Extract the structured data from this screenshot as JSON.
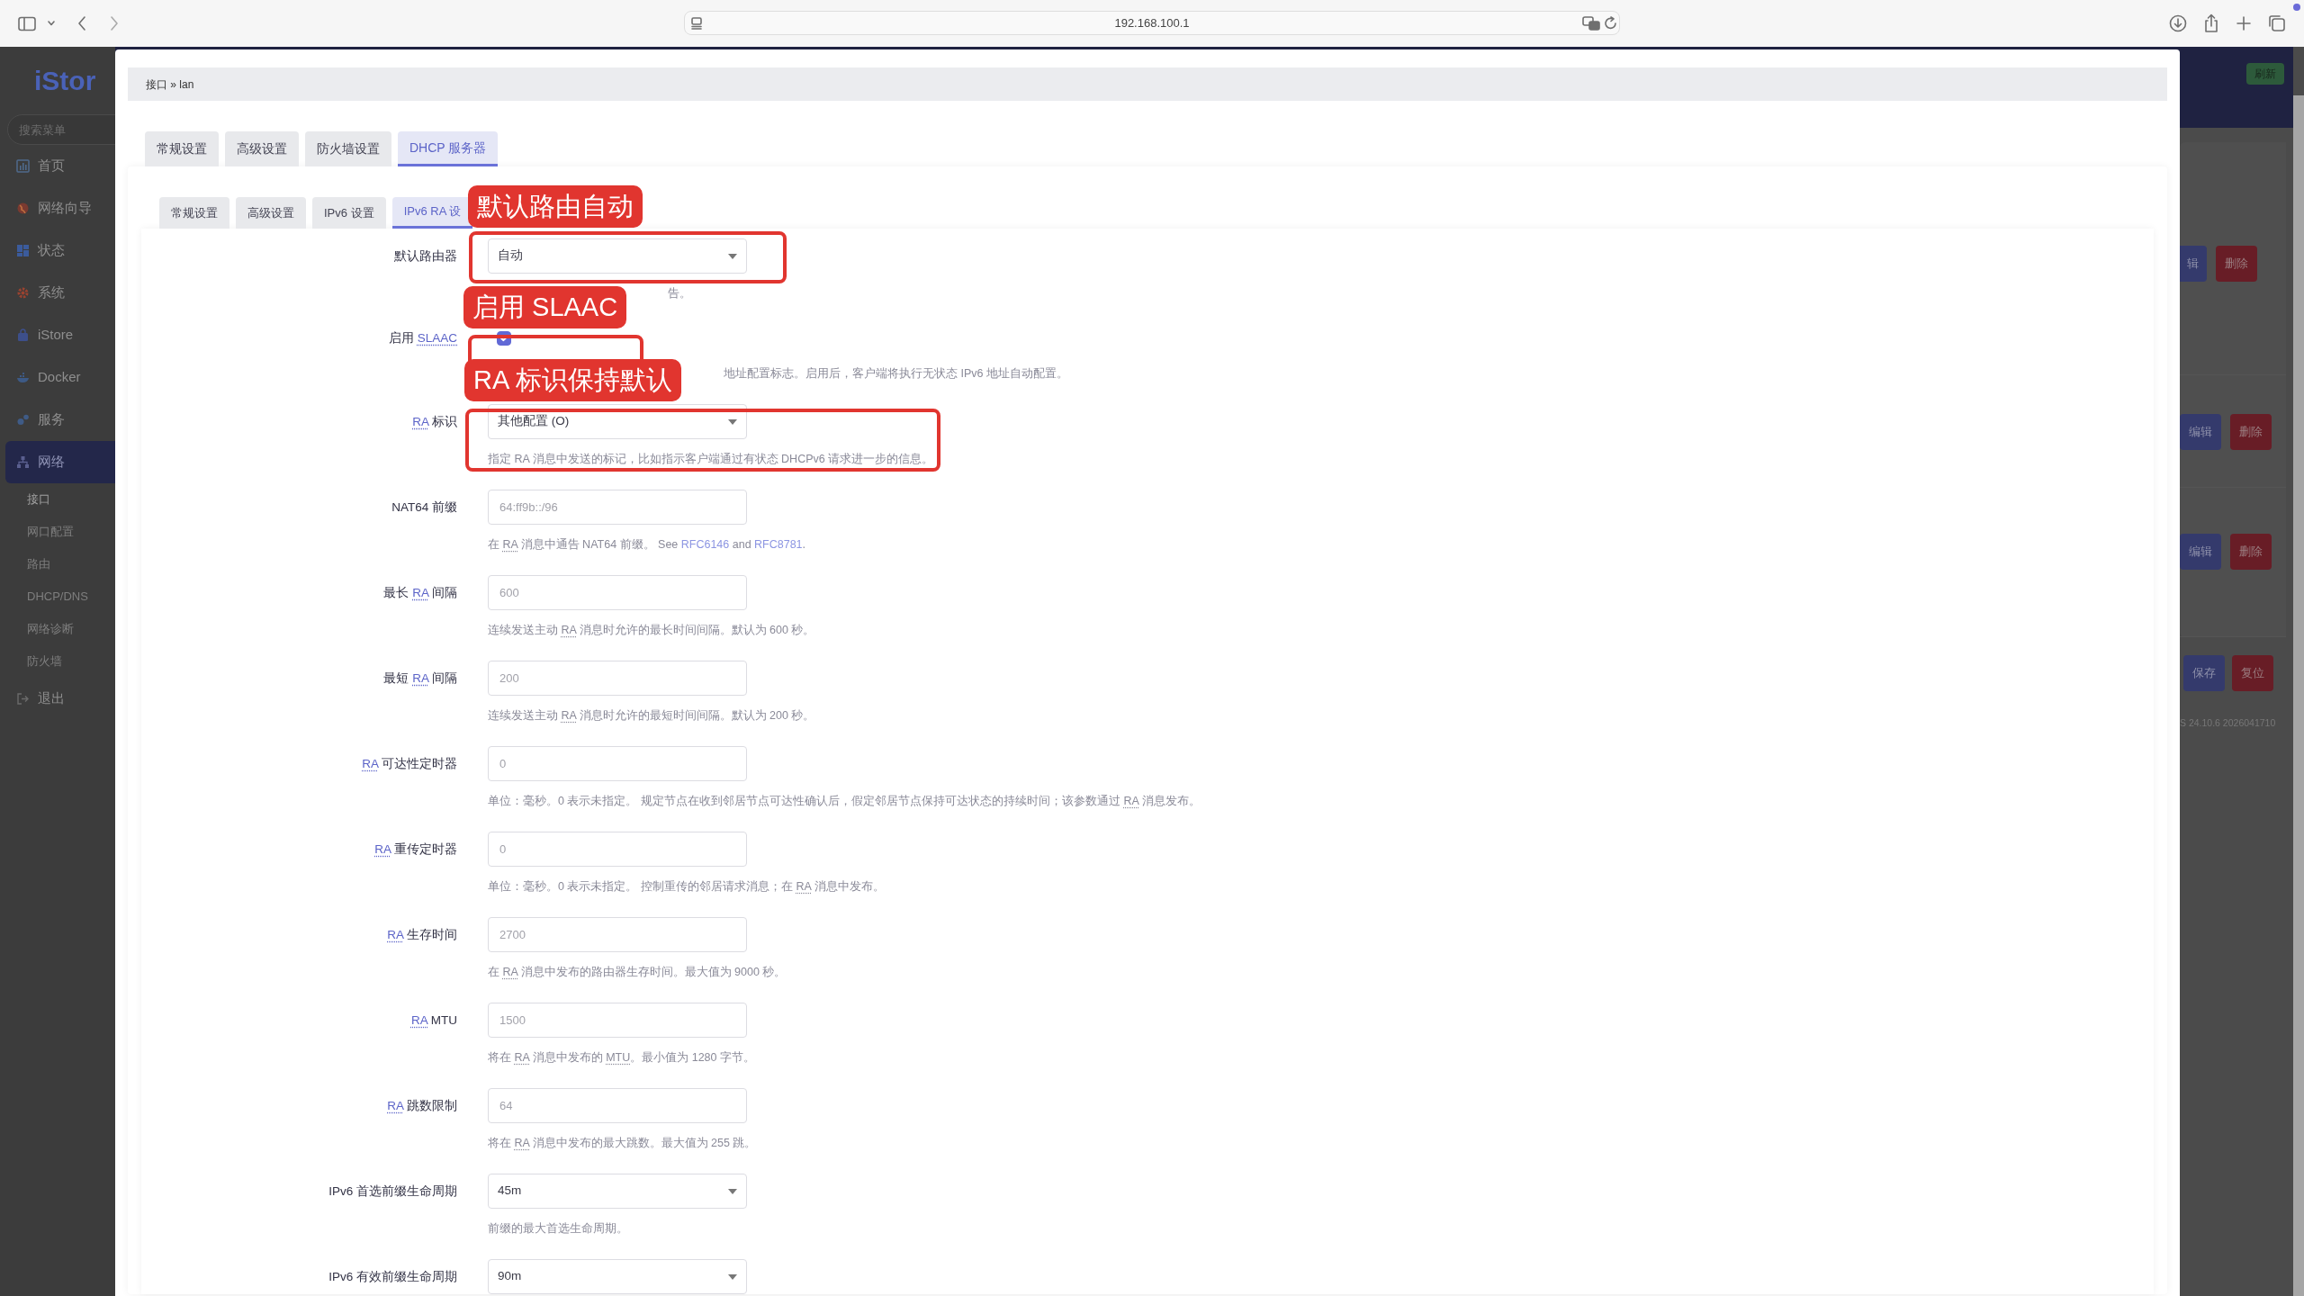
{
  "browser": {
    "address": "192.168.100.1"
  },
  "sidebar": {
    "logo": "iStor",
    "search": {
      "placeholder": "搜索菜单"
    },
    "items": [
      {
        "label": "首页",
        "selected": false
      },
      {
        "label": "网络向导",
        "selected": false
      },
      {
        "label": "状态",
        "selected": false
      },
      {
        "label": "系统",
        "selected": false
      },
      {
        "label": "iStore",
        "selected": false
      },
      {
        "label": "Docker",
        "selected": false
      },
      {
        "label": "服务",
        "selected": false
      },
      {
        "label": "网络",
        "selected": true,
        "children": [
          {
            "label": "接口",
            "selected": true
          },
          {
            "label": "网口配置",
            "selected": false
          },
          {
            "label": "路由",
            "selected": false
          },
          {
            "label": "DHCP/DNS",
            "selected": false
          },
          {
            "label": "网络诊断",
            "selected": false
          },
          {
            "label": "防火墙",
            "selected": false
          }
        ]
      },
      {
        "label": "退出",
        "selected": false
      }
    ]
  },
  "header": {
    "refresh": "刷新"
  },
  "background_rows": [
    {
      "edit": "辑",
      "delete": "删除"
    },
    {
      "edit": "编辑",
      "delete": "删除"
    },
    {
      "edit": "编辑",
      "delete": "删除"
    }
  ],
  "background_actions": {
    "save": "保存",
    "reset": "复位"
  },
  "background_footer": "S 24.10.6 2026041710",
  "dialog": {
    "breadcrumb": "接口 » lan",
    "tabs": [
      {
        "label": "常规设置",
        "selected": false
      },
      {
        "label": "高级设置",
        "selected": false
      },
      {
        "label": "防火墙设置",
        "selected": false
      },
      {
        "label": "DHCP 服务器",
        "selected": true
      }
    ],
    "subtabs": [
      {
        "label": "常规设置",
        "selected": false
      },
      {
        "label": "高级设置",
        "selected": false
      },
      {
        "label": "IPv6 设置",
        "selected": false
      },
      {
        "label": "IPv6 RA 设",
        "selected": true
      }
    ],
    "fields": [
      {
        "kind": "select",
        "label": [
          {
            "kind": "text",
            "text": "默认路由器"
          }
        ],
        "value": "自动",
        "description": [
          {
            "kind": "text",
            "text": "告。"
          }
        ]
      },
      {
        "kind": "checkbox",
        "label": [
          {
            "kind": "text",
            "text": "启用 "
          },
          {
            "kind": "abbr",
            "text": "SLAAC"
          }
        ],
        "checked": true,
        "description": [
          {
            "kind": "text",
            "text": "地址配置标志。启用后，客户端将执行无状态 IPv6 地址自动配置。"
          }
        ]
      },
      {
        "kind": "select",
        "label": [
          {
            "kind": "abbr",
            "text": "RA"
          },
          {
            "kind": "text",
            "text": " 标识"
          }
        ],
        "value": "其他配置 (O)",
        "description": [
          {
            "kind": "text",
            "text": "指定 RA 消息中发送的标记，比如指示客户端通过有状态 DHCPv6 请求进一步的信息。"
          }
        ]
      },
      {
        "kind": "input",
        "label": [
          {
            "kind": "text",
            "text": "NAT64 前缀"
          }
        ],
        "placeholder": "64:ff9b::/96",
        "description": [
          {
            "kind": "text",
            "text": "在 "
          },
          {
            "kind": "abbr",
            "text": "RA"
          },
          {
            "kind": "text",
            "text": " 消息中通告 NAT64 前缀。 See "
          },
          {
            "kind": "link",
            "text": "RFC6146"
          },
          {
            "kind": "text",
            "text": " and "
          },
          {
            "kind": "link",
            "text": "RFC8781"
          },
          {
            "kind": "text",
            "text": "."
          }
        ]
      },
      {
        "kind": "input",
        "label": [
          {
            "kind": "text",
            "text": "最长 "
          },
          {
            "kind": "abbr",
            "text": "RA"
          },
          {
            "kind": "text",
            "text": " 间隔"
          }
        ],
        "placeholder": "600",
        "description": [
          {
            "kind": "text",
            "text": "连续发送主动 "
          },
          {
            "kind": "abbr",
            "text": "RA"
          },
          {
            "kind": "text",
            "text": " 消息时允许的最长时间间隔。默认为 600 秒。"
          }
        ]
      },
      {
        "kind": "input",
        "label": [
          {
            "kind": "text",
            "text": "最短 "
          },
          {
            "kind": "abbr",
            "text": "RA"
          },
          {
            "kind": "text",
            "text": " 间隔"
          }
        ],
        "placeholder": "200",
        "description": [
          {
            "kind": "text",
            "text": "连续发送主动 "
          },
          {
            "kind": "abbr",
            "text": "RA"
          },
          {
            "kind": "text",
            "text": " 消息时允许的最短时间间隔。默认为 200 秒。"
          }
        ]
      },
      {
        "kind": "input",
        "label": [
          {
            "kind": "abbr",
            "text": "RA"
          },
          {
            "kind": "text",
            "text": " 可达性定时器"
          }
        ],
        "placeholder": "0",
        "description": [
          {
            "kind": "text",
            "text": "单位：毫秒。0 表示未指定。 规定节点在收到邻居节点可达性确认后，假定邻居节点保持可达状态的持续时间；该参数通过 "
          },
          {
            "kind": "abbr",
            "text": "RA"
          },
          {
            "kind": "text",
            "text": " 消息发布。"
          }
        ]
      },
      {
        "kind": "input",
        "label": [
          {
            "kind": "abbr",
            "text": "RA"
          },
          {
            "kind": "text",
            "text": " 重传定时器"
          }
        ],
        "placeholder": "0",
        "description": [
          {
            "kind": "text",
            "text": "单位：毫秒。0 表示未指定。 控制重传的邻居请求消息；在 "
          },
          {
            "kind": "abbr",
            "text": "RA"
          },
          {
            "kind": "text",
            "text": " 消息中发布。"
          }
        ]
      },
      {
        "kind": "input",
        "label": [
          {
            "kind": "abbr",
            "text": "RA"
          },
          {
            "kind": "text",
            "text": " 生存时间"
          }
        ],
        "placeholder": "2700",
        "description": [
          {
            "kind": "text",
            "text": "在 "
          },
          {
            "kind": "abbr",
            "text": "RA"
          },
          {
            "kind": "text",
            "text": " 消息中发布的路由器生存时间。最大值为 9000 秒。"
          }
        ]
      },
      {
        "kind": "input",
        "label": [
          {
            "kind": "abbr",
            "text": "RA"
          },
          {
            "kind": "text",
            "text": " MTU"
          }
        ],
        "placeholder": "1500",
        "description": [
          {
            "kind": "text",
            "text": "将在 "
          },
          {
            "kind": "abbr",
            "text": "RA"
          },
          {
            "kind": "text",
            "text": " 消息中发布的 "
          },
          {
            "kind": "abbr",
            "text": "MTU"
          },
          {
            "kind": "text",
            "text": "。最小值为 1280 字节。"
          }
        ]
      },
      {
        "kind": "input",
        "label": [
          {
            "kind": "abbr",
            "text": "RA"
          },
          {
            "kind": "text",
            "text": " 跳数限制"
          }
        ],
        "placeholder": "64",
        "description": [
          {
            "kind": "text",
            "text": "将在 "
          },
          {
            "kind": "abbr",
            "text": "RA"
          },
          {
            "kind": "text",
            "text": " 消息中发布的最大跳数。最大值为 255 跳。"
          }
        ]
      },
      {
        "kind": "select",
        "label": [
          {
            "kind": "text",
            "text": "IPv6 首选前缀生命周期"
          }
        ],
        "value": "45m",
        "description": [
          {
            "kind": "text",
            "text": "前缀的最大首选生命周期。"
          }
        ]
      },
      {
        "kind": "select",
        "label": [
          {
            "kind": "text",
            "text": "IPv6 有效前缀生命周期"
          }
        ],
        "value": "90m"
      }
    ],
    "annotations": [
      {
        "kind": "label",
        "text": "默认路由自动"
      },
      {
        "kind": "frame"
      },
      {
        "kind": "label",
        "text": "启用 SLAAC"
      },
      {
        "kind": "frame"
      },
      {
        "kind": "label",
        "text": "RA 标识保持默认"
      },
      {
        "kind": "frame"
      }
    ]
  }
}
